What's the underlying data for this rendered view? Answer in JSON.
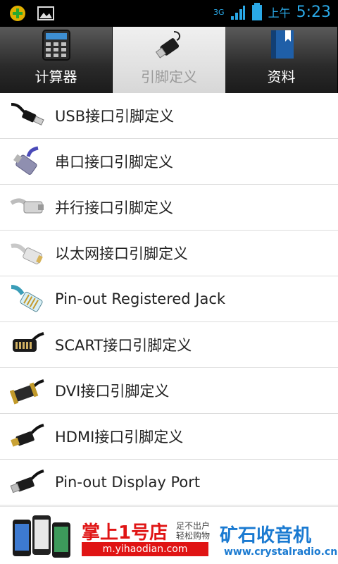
{
  "status": {
    "time": "5:23",
    "ampm": "上午",
    "network": "3G"
  },
  "tabs": [
    {
      "label": "计算器",
      "icon": "calculator-icon",
      "active": false
    },
    {
      "label": "引脚定义",
      "icon": "usb-icon",
      "active": true
    },
    {
      "label": "资料",
      "icon": "book-icon",
      "active": false
    }
  ],
  "list": [
    {
      "label": "USB接口引脚定义",
      "icon": "usb-cable-icon"
    },
    {
      "label": "串口接口引脚定义",
      "icon": "serial-port-icon"
    },
    {
      "label": "并行接口引脚定义",
      "icon": "parallel-port-icon"
    },
    {
      "label": "以太网接口引脚定义",
      "icon": "ethernet-icon"
    },
    {
      "label": "Pin-out Registered Jack",
      "icon": "rj-jack-icon"
    },
    {
      "label": "SCART接口引脚定义",
      "icon": "scart-icon"
    },
    {
      "label": "DVI接口引脚定义",
      "icon": "dvi-icon"
    },
    {
      "label": "HDMI接口引脚定义",
      "icon": "hdmi-icon"
    },
    {
      "label": "Pin-out Display Port",
      "icon": "displayport-icon"
    }
  ],
  "ad": {
    "brand": "掌上1号店",
    "slogan": "足不出户轻松购物",
    "url": "m.yihaodian.com",
    "right_title": "矿石收音机",
    "right_url": "www.crystalradio.cn"
  }
}
